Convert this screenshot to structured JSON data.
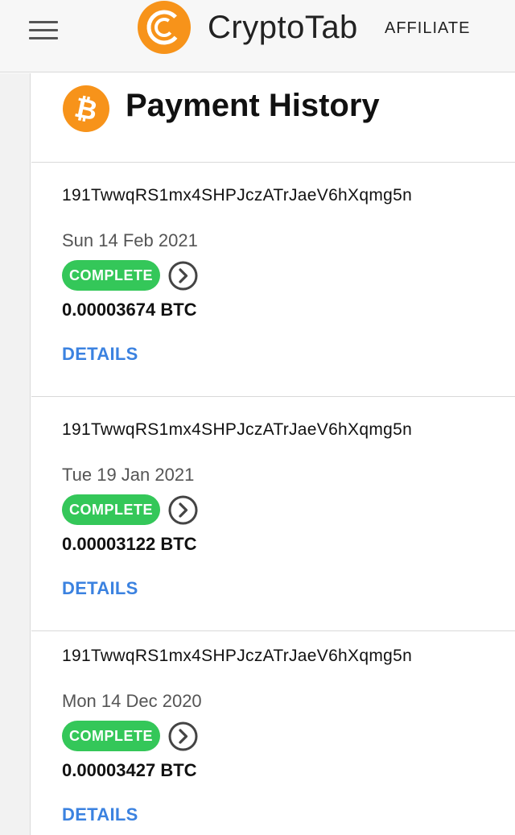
{
  "header": {
    "brand": "CryptoTab",
    "brand_sub": "AFFILIATE",
    "brand_color": "#f7931a",
    "menu_icon": "hamburger-menu-icon"
  },
  "page": {
    "title": "Payment History",
    "title_icon": "bitcoin-icon"
  },
  "payments": [
    {
      "address": "191TwwqRS1mx4SHPJczATrJaeV6hXqmg5n",
      "date": "Sun 14 Feb 2021",
      "status": "COMPLETE",
      "amount": "0.00003674 BTC",
      "details_label": "DETAILS"
    },
    {
      "address": "191TwwqRS1mx4SHPJczATrJaeV6hXqmg5n",
      "date": "Tue 19 Jan 2021",
      "status": "COMPLETE",
      "amount": "0.00003122 BTC",
      "details_label": "DETAILS"
    },
    {
      "address": "191TwwqRS1mx4SHPJczATrJaeV6hXqmg5n",
      "date": "Mon 14 Dec 2020",
      "status": "COMPLETE",
      "amount": "0.00003427 BTC",
      "details_label": "DETAILS"
    }
  ],
  "colors": {
    "status_complete": "#34c759",
    "link": "#3b82e0"
  }
}
